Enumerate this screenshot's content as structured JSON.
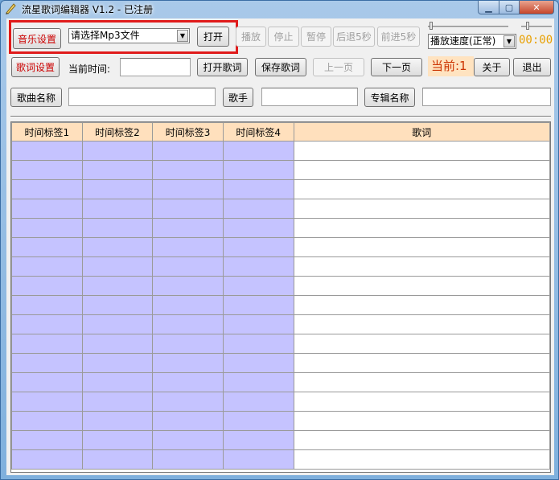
{
  "titlebar": {
    "title": "流星歌词编辑器 V1.2 - 已注册"
  },
  "toolbar1": {
    "music_settings": "音乐设置",
    "file_combo_value": "请选择Mp3文件",
    "open": "打开",
    "play": "播放",
    "stop": "停止",
    "pause": "暂停",
    "rewind5": "后退5秒",
    "forward5": "前进5秒",
    "speed_value": "播放速度(正常)",
    "timecode": "00:00"
  },
  "toolbar2": {
    "lyric_settings": "歌词设置",
    "current_time_label": "当前时间:",
    "current_time_value": "",
    "open_lyrics": "打开歌词",
    "save_lyrics": "保存歌词",
    "prev_page": "上一页",
    "next_page": "下一页",
    "current_page": "当前:1",
    "about": "关于",
    "exit": "退出"
  },
  "toolbar3": {
    "song_name_label": "歌曲名称",
    "song_name_value": "",
    "singer_label": "歌手",
    "singer_value": "",
    "album_label": "专辑名称",
    "album_value": ""
  },
  "grid": {
    "columns": [
      "时间标签1",
      "时间标签2",
      "时间标签3",
      "时间标签4",
      "歌词"
    ],
    "row_count": 17
  }
}
